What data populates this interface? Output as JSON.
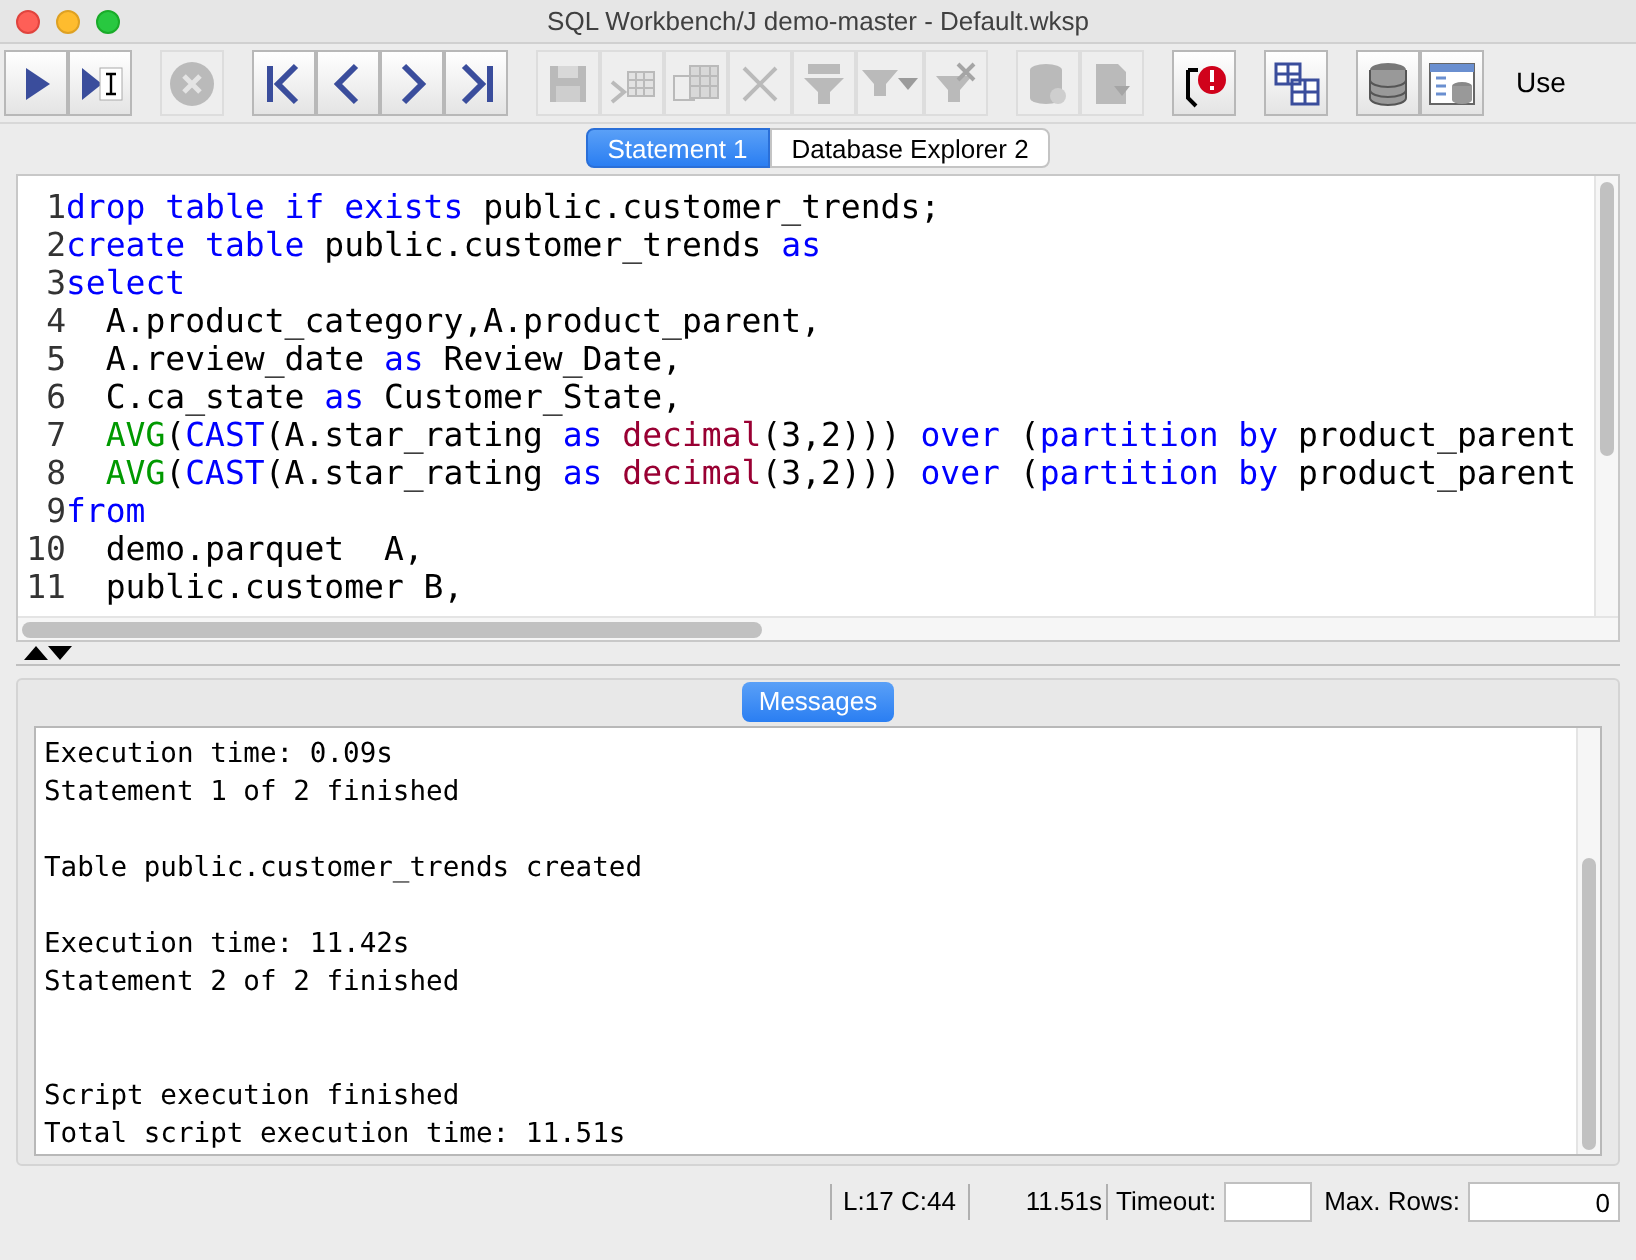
{
  "window": {
    "title": "SQL Workbench/J demo-master - Default.wksp"
  },
  "toolbar": {
    "groups": [
      [
        {
          "kind": "run",
          "disabled": false
        },
        {
          "kind": "run_current",
          "disabled": false
        }
      ],
      [
        {
          "kind": "stop",
          "disabled": true
        }
      ],
      [
        {
          "kind": "first",
          "disabled": false
        },
        {
          "kind": "prev",
          "disabled": false
        },
        {
          "kind": "next",
          "disabled": false
        },
        {
          "kind": "last",
          "disabled": false
        }
      ],
      [
        {
          "kind": "save",
          "disabled": true
        },
        {
          "kind": "table_arrow",
          "disabled": true
        },
        {
          "kind": "table_copy",
          "disabled": true
        },
        {
          "kind": "delete",
          "disabled": true
        },
        {
          "kind": "funnel_table",
          "disabled": true
        },
        {
          "kind": "funnel_menu",
          "disabled": true
        },
        {
          "kind": "funnel_x",
          "disabled": true
        }
      ],
      [
        {
          "kind": "db_check",
          "disabled": true
        },
        {
          "kind": "doc_arrow",
          "disabled": true
        }
      ],
      [
        {
          "kind": "error",
          "disabled": false
        }
      ],
      [
        {
          "kind": "grid",
          "disabled": false
        }
      ],
      [
        {
          "kind": "database",
          "disabled": false
        },
        {
          "kind": "db_window",
          "disabled": false
        }
      ]
    ],
    "cut_label": "Use"
  },
  "tabs": [
    {
      "label": "Statement 1",
      "selected": true
    },
    {
      "label": "Database Explorer 2",
      "selected": false
    }
  ],
  "editor": {
    "lines": [
      {
        "number": "1",
        "tokens": [
          {
            "text": "drop table if exists",
            "kind": "keyword"
          },
          {
            "text": " public.customer_trends;",
            "kind": "plain"
          }
        ]
      },
      {
        "number": "2",
        "tokens": [
          {
            "text": "create table",
            "kind": "keyword"
          },
          {
            "text": " public.customer_trends ",
            "kind": "plain"
          },
          {
            "text": "as",
            "kind": "keyword"
          }
        ]
      },
      {
        "number": "3",
        "tokens": [
          {
            "text": "select",
            "kind": "keyword"
          }
        ]
      },
      {
        "number": "4",
        "tokens": [
          {
            "text": "  A.product_category,A.product_parent,",
            "kind": "plain"
          }
        ]
      },
      {
        "number": "5",
        "tokens": [
          {
            "text": "  A.review_date ",
            "kind": "plain"
          },
          {
            "text": "as",
            "kind": "keyword"
          },
          {
            "text": " Review_Date,",
            "kind": "plain"
          }
        ]
      },
      {
        "number": "6",
        "tokens": [
          {
            "text": "  C.ca_state ",
            "kind": "plain"
          },
          {
            "text": "as",
            "kind": "keyword"
          },
          {
            "text": " Customer_State,",
            "kind": "plain"
          }
        ]
      },
      {
        "number": "7",
        "tokens": [
          {
            "text": "  AVG",
            "kind": "function"
          },
          {
            "text": "(",
            "kind": "plain"
          },
          {
            "text": "CAST",
            "kind": "keyword"
          },
          {
            "text": "(A.star_rating ",
            "kind": "plain"
          },
          {
            "text": "as",
            "kind": "keyword"
          },
          {
            "text": " decimal",
            "kind": "type"
          },
          {
            "text": "(3,2))) ",
            "kind": "plain"
          },
          {
            "text": "over",
            "kind": "keyword"
          },
          {
            "text": " (",
            "kind": "plain"
          },
          {
            "text": "partition by",
            "kind": "keyword"
          },
          {
            "text": " product_parent",
            "kind": "plain"
          }
        ]
      },
      {
        "number": "8",
        "tokens": [
          {
            "text": "  AVG",
            "kind": "function"
          },
          {
            "text": "(",
            "kind": "plain"
          },
          {
            "text": "CAST",
            "kind": "keyword"
          },
          {
            "text": "(A.star_rating ",
            "kind": "plain"
          },
          {
            "text": "as",
            "kind": "keyword"
          },
          {
            "text": " decimal",
            "kind": "type"
          },
          {
            "text": "(3,2))) ",
            "kind": "plain"
          },
          {
            "text": "over",
            "kind": "keyword"
          },
          {
            "text": " (",
            "kind": "plain"
          },
          {
            "text": "partition by",
            "kind": "keyword"
          },
          {
            "text": " product_parent",
            "kind": "plain"
          }
        ]
      },
      {
        "number": "9",
        "tokens": [
          {
            "text": "from",
            "kind": "keyword"
          }
        ]
      },
      {
        "number": "10",
        "tokens": [
          {
            "text": "  demo.parquet  A,",
            "kind": "plain"
          }
        ]
      },
      {
        "number": "11",
        "tokens": [
          {
            "text": "  public.customer B,",
            "kind": "plain"
          }
        ]
      }
    ]
  },
  "messages": {
    "title": "Messages",
    "blocks": [
      {
        "kind": "result",
        "lines": [
          "Execution time: 0.09s",
          "Statement 1 of 2 finished"
        ]
      },
      {
        "kind": "result",
        "lines": [
          "Table public.customer_trends created"
        ]
      },
      {
        "kind": "result",
        "lines": [
          "Execution time: 11.42s",
          "Statement 2 of 2 finished"
        ]
      },
      {
        "kind": "summary",
        "lines": [
          "Script execution finished",
          "Total script execution time: 11.51s"
        ]
      }
    ]
  },
  "status_bar": {
    "position": "L:17 C:44",
    "elapsed": "11.51s",
    "timeout_label": "Timeout:",
    "max_rows_label": "Max. Rows:",
    "max_rows": "0"
  }
}
